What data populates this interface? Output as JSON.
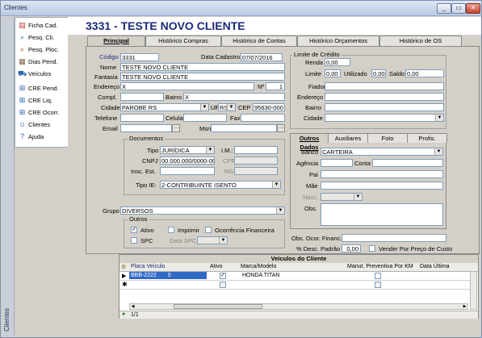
{
  "window": {
    "title": "Clientes",
    "side_label": "Clientes",
    "controls": {
      "minimize": "_",
      "restore": "▭",
      "close": "✕"
    }
  },
  "menu": [
    {
      "label": "Ficha Cad.",
      "icon": "id-card-icon"
    },
    {
      "label": "Pesq. Cli.",
      "icon": "search-client-icon"
    },
    {
      "label": "Pesq. Ploc.",
      "icon": "search-ploc-icon"
    },
    {
      "label": "Dias Pend.",
      "icon": "pending-days-icon"
    },
    {
      "label": "Veículos",
      "icon": "car-icon"
    },
    {
      "label": "CRE Pend.",
      "icon": "cre-pend-icon"
    },
    {
      "label": "CRE Liq.",
      "icon": "cre-liq-icon"
    },
    {
      "label": "CRE Ocorr.",
      "icon": "cre-ocorr-icon"
    },
    {
      "label": "Clientes",
      "icon": "clients-icon"
    },
    {
      "label": "Ajuda",
      "icon": "help-icon"
    }
  ],
  "header": {
    "title": "3331 - TESTE NOVO CLIENTE"
  },
  "tabs": [
    "Principal",
    "Histórico Compras",
    "Histórico de Contas",
    "Histórico Orçamentos",
    "Histórico de OS"
  ],
  "form": {
    "codigo_label": "Código",
    "codigo": "3331",
    "data_cadastro_label": "Data Cadastro",
    "data_cadastro": "07/07/2016",
    "nome_label": "Nome",
    "nome": "TESTE NOVO CLIENTE",
    "fantasia_label": "Fantasia",
    "fantasia": "TESTE NOVO CLIENTE",
    "endereco_label": "Endereço",
    "endereco": "X",
    "numero_label": "Nº",
    "numero": "1",
    "compl_label": "Compl.",
    "compl": "",
    "bairro_label": "Bairro",
    "bairro": "X",
    "cidade_label": "Cidade",
    "cidade": "PAROBE   RS",
    "uf_label": "UF",
    "uf": "RS",
    "cep_label": "CEP",
    "cep": "95630-000",
    "telefone_label": "Telefone",
    "telefone": "",
    "celular_label": "Celular",
    "celular": "",
    "fax_label": "Fax",
    "fax": "",
    "email_label": "Email",
    "email": "",
    "msn_label": "Msn",
    "msn": "",
    "documentos_label": "Documentos",
    "tipo_label": "Tipo",
    "tipo": "JURÍDICA",
    "im_label": "I.M.:",
    "im": "",
    "cnpj_label": "CNPJ",
    "cnpj": "00.000.000/0000-00",
    "cpf_label": "CPF",
    "cpf": "",
    "insc_est_label": "Insc. Est.",
    "insc_est": "",
    "rg_label": "RG",
    "rg": "",
    "tipo_ie_label": "Tipo IE:",
    "tipo_ie": "2-CONTRIBUINTE ISENTO",
    "grupo_label": "Grupo",
    "grupo": "DIVERSOS",
    "outros_label": "Outros",
    "ativo_label": "Ativo",
    "ativo": true,
    "imprimir_label": "Imprimir",
    "imprimir": false,
    "ocorrencia_label": "Ocorrência Financeira",
    "ocorrencia": false,
    "spc_label": "SPC",
    "spc": false,
    "data_spc_label": "Data SPC",
    "data_spc": ""
  },
  "credito": {
    "title": "Limite de Crédito",
    "renda_label": "Renda",
    "renda": "0,00",
    "limite_label": "Limite",
    "limite": "0,00",
    "utilizado_label": "Utilizado",
    "utilizado": "0,00",
    "saldo_label": "Saldo",
    "saldo": "0,00",
    "fiador_label": "Fiador",
    "fiador": "",
    "endereco_label": "Endereço",
    "endereco": "",
    "bairro_label": "Bairro",
    "bairro": "",
    "cidade_label": "Cidade",
    "cidade": ""
  },
  "subtabs": [
    "Outros Dados",
    "Auxiliares",
    "Foto",
    "Profis."
  ],
  "outros": {
    "banco_label": "Banco",
    "banco": "CARTEIRA",
    "agencia_label": "Agência",
    "agencia": "",
    "conta_label": "Conta",
    "conta": "",
    "pai_label": "Pai",
    "pai": "",
    "mae_label": "Mãe",
    "mae": "",
    "nasc_label": "Nasc.",
    "nasc": "",
    "obs_label": "Obs.",
    "obs": "",
    "obs_ocor_label": "Obs. Ocor. Financ.",
    "obs_ocor": "",
    "desc_label": "% Desc. Padrão",
    "desc": "0,00",
    "vender_label": "Vender Por Preço de Custo",
    "vender": false
  },
  "veiculos": {
    "title": "Veículos do Cliente",
    "columns": [
      "Placa Veículo",
      "Ativo",
      "Marca/Modelo",
      "Manut. Preventiva Por KM",
      "Data Última"
    ],
    "rows": [
      {
        "placa": "BBB-2222",
        "num": "0",
        "ativo": true,
        "marca": "HONDA TITAN",
        "manut": false
      }
    ],
    "record_count": "1/1"
  }
}
